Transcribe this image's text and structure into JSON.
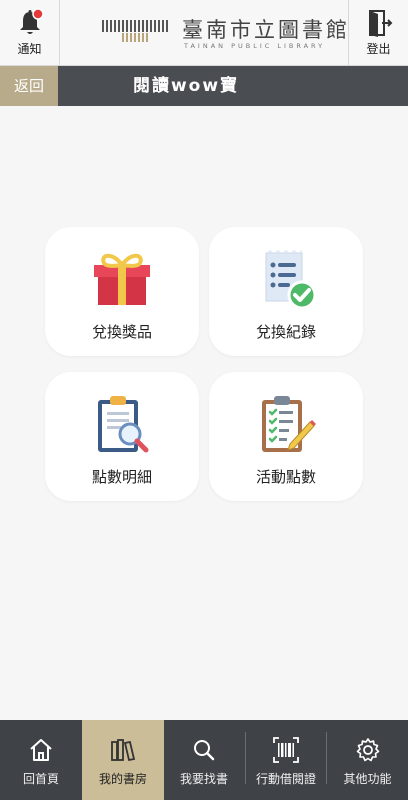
{
  "header": {
    "notify_label": "通知",
    "logout_label": "登出",
    "logo_title": "臺南市立圖書館",
    "logo_subtitle": "TAINAN PUBLIC LIBRARY",
    "notify_badge_color": "#e63a3a"
  },
  "titlebar": {
    "back_label": "返回",
    "title": "閱讀wow寶"
  },
  "menu": {
    "items": [
      {
        "label": "兌換獎品",
        "icon": "gift-icon"
      },
      {
        "label": "兌換紀錄",
        "icon": "receipt-check-icon"
      },
      {
        "label": "點數明細",
        "icon": "clipboard-search-icon"
      },
      {
        "label": "活動點數",
        "icon": "checklist-pencil-icon"
      }
    ]
  },
  "bottomnav": {
    "items": [
      {
        "label": "回首頁",
        "icon": "home-icon"
      },
      {
        "label": "我的書房",
        "icon": "books-icon",
        "active": true
      },
      {
        "label": "我要找書",
        "icon": "search-icon"
      },
      {
        "label": "行動借閱證",
        "icon": "barcode-icon"
      },
      {
        "label": "其他功能",
        "icon": "gear-icon"
      }
    ]
  },
  "colors": {
    "titlebar_bg": "#4a4d52",
    "accent_gold": "#b8ab8b",
    "nav_bg": "#3f4247",
    "nav_active": "#cbbd98"
  }
}
